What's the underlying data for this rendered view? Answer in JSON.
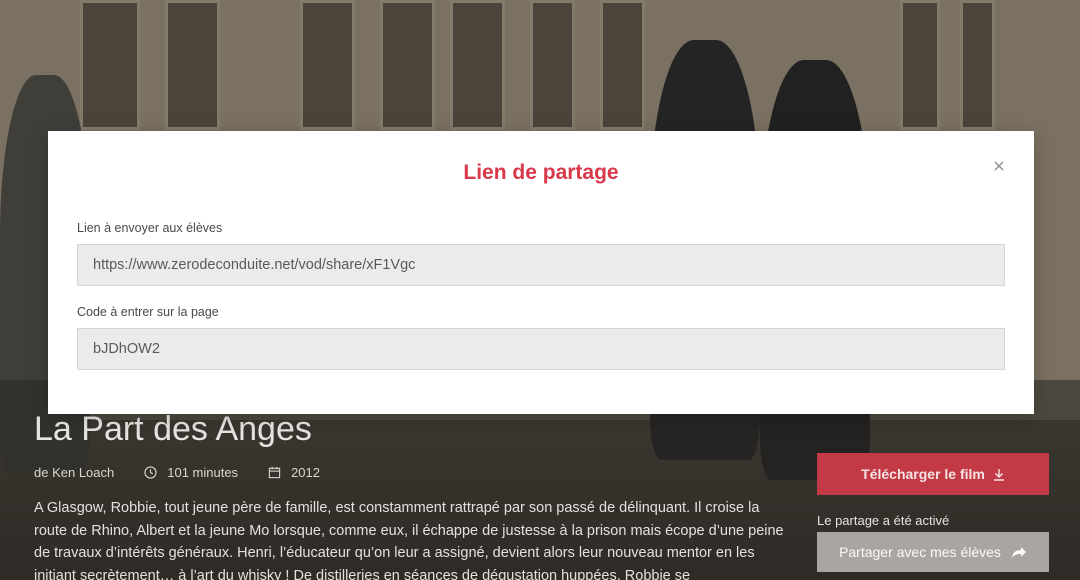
{
  "modal": {
    "title": "Lien de partage",
    "close_icon": "close-icon",
    "link_label": "Lien à envoyer aux élèves",
    "link_value": "https://www.zerodeconduite.net/vod/share/xF1Vgc",
    "code_label": "Code à entrer sur la page",
    "code_value": "bJDhOW2"
  },
  "film": {
    "title": "La Part des Anges",
    "director": "de Ken Loach",
    "duration": "101 minutes",
    "duration_icon": "clock-icon",
    "year": "2012",
    "year_icon": "calendar-icon",
    "synopsis": "A Glasgow, Robbie, tout jeune père de famille, est constamment rattrapé par son passé de délinquant. Il croise la route de Rhino, Albert et la jeune Mo lorsque, comme eux, il échappe de justesse à la prison mais écope d’une peine de travaux d’intérêts généraux. Henri, l’éducateur qu’on leur a assigné, devient alors leur nouveau mentor en les initiant secrètement… à l’art du whisky ! De distilleries en séances de dégustation huppées, Robbie se"
  },
  "actions": {
    "download_label": "Télécharger le film",
    "download_icon": "download-icon",
    "share_status": "Le partage a été activé",
    "share_label": "Partager avec mes élèves",
    "share_icon": "share-arrow-icon"
  },
  "colors": {
    "accent": "#d8394b",
    "download_bg": "#c23a45",
    "share_bg": "#a9a6a2"
  }
}
